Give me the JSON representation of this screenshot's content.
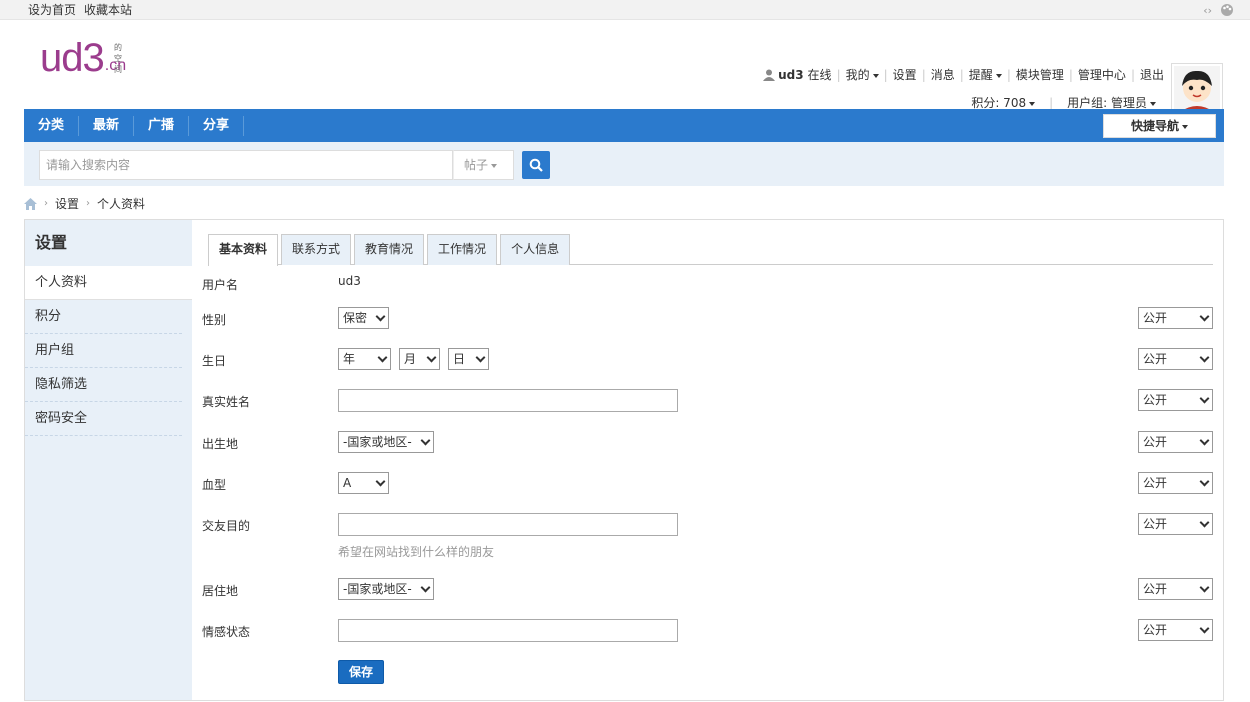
{
  "topbar": {
    "set_home": "设为首页",
    "bookmark": "收藏本站"
  },
  "logo": {
    "main": "ud3",
    "cn": ".cn",
    "sub": "的空间"
  },
  "user": {
    "name": "ud3",
    "status": "在线",
    "mine": "我的",
    "settings": "设置",
    "messages": "消息",
    "reminders": "提醒",
    "module_manage": "模块管理",
    "admin_center": "管理中心",
    "logout": "退出",
    "points": "积分: 708",
    "usergroup": "用户组: 管理员"
  },
  "nav": {
    "items": [
      "分类",
      "最新",
      "广播",
      "分享"
    ],
    "quick_nav": "快捷导航"
  },
  "search": {
    "placeholder": "请输入搜索内容",
    "type": "帖子"
  },
  "breadcrumb": {
    "settings": "设置",
    "current": "个人资料"
  },
  "sidebar": {
    "title": "设置",
    "items": [
      "个人资料",
      "积分",
      "用户组",
      "隐私筛选",
      "密码安全"
    ]
  },
  "tabs": [
    "基本资料",
    "联系方式",
    "教育情况",
    "工作情况",
    "个人信息"
  ],
  "form": {
    "username_label": "用户名",
    "username_value": "ud3",
    "gender_label": "性别",
    "gender_value": "保密",
    "birthday_label": "生日",
    "year": "年",
    "month": "月",
    "day": "日",
    "realname_label": "真实姓名",
    "birthplace_label": "出生地",
    "country_placeholder": "-国家或地区-",
    "blood_label": "血型",
    "blood_value": "A",
    "purpose_label": "交友目的",
    "purpose_hint": "希望在网站找到什么样的朋友",
    "residence_label": "居住地",
    "relationship_label": "情感状态",
    "privacy": "公开",
    "save": "保存"
  },
  "colors": {
    "nav_blue": "#2b7acd",
    "logo_purple": "#9b3c8d",
    "sidebar_bg": "#e8f0f8"
  }
}
